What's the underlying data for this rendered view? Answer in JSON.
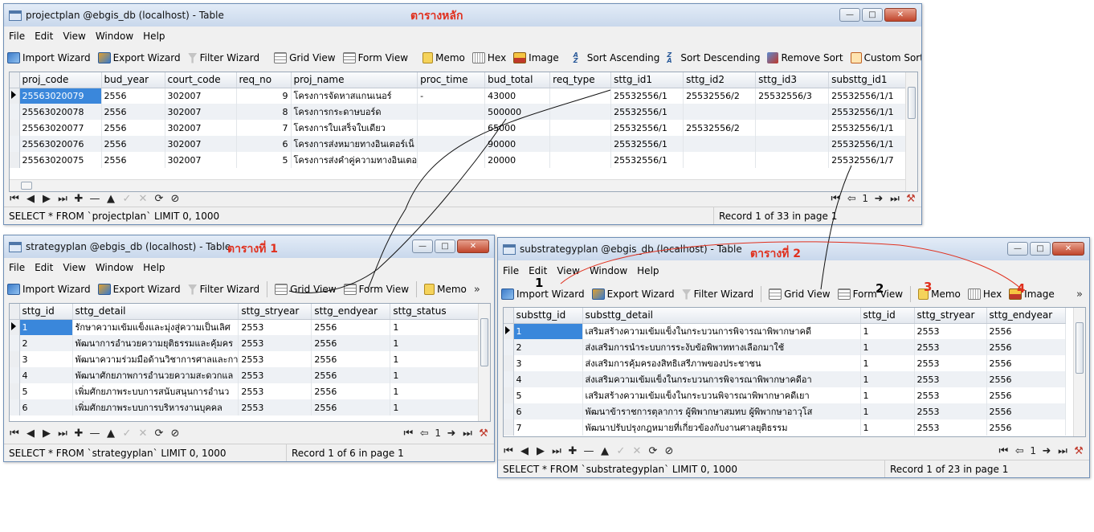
{
  "windows": {
    "project": {
      "title": "projectplan @ebgis_db (localhost) - Table",
      "annotation": "ตารางหลัก",
      "menu": [
        "File",
        "Edit",
        "View",
        "Window",
        "Help"
      ],
      "toolbar": {
        "import": "Import Wizard",
        "export": "Export Wizard",
        "filter": "Filter Wizard",
        "grid": "Grid View",
        "form": "Form View",
        "memo": "Memo",
        "hex": "Hex",
        "image": "Image",
        "sort_asc": "Sort Ascending",
        "sort_desc": "Sort Descending",
        "remove_sort": "Remove Sort",
        "custom_sort": "Custom Sort"
      },
      "columns": [
        "proj_code",
        "bud_year",
        "court_code",
        "req_no",
        "proj_name",
        "proc_time",
        "bud_total",
        "req_type",
        "sttg_id1",
        "sttg_id2",
        "sttg_id3",
        "substtg_id1"
      ],
      "rows": [
        [
          "25563020079",
          "2556",
          "302007",
          "9",
          "โครงการจัดหาสแกนเนอร์",
          "-",
          "43000",
          "",
          "25532556/1",
          "25532556/2",
          "25532556/3",
          "25532556/1/1"
        ],
        [
          "25563020078",
          "2556",
          "302007",
          "8",
          "โครงการกระดาษบอร์ด",
          "",
          "500000",
          "",
          "25532556/1",
          "",
          "",
          "25532556/1/1"
        ],
        [
          "25563020077",
          "2556",
          "302007",
          "7",
          "โครงการใบเสร็จใบเดียว",
          "",
          "65000",
          "",
          "25532556/1",
          "25532556/2",
          "",
          "25532556/1/1"
        ],
        [
          "25563020076",
          "2556",
          "302007",
          "6",
          "โครงการส่งหมายทางอินเตอร์เน็",
          "",
          "90000",
          "",
          "25532556/1",
          "",
          "",
          "25532556/1/1"
        ],
        [
          "25563020075",
          "2556",
          "302007",
          "5",
          "โครงการส่งคำคู่ความทางอินเตอ",
          "",
          "20000",
          "",
          "25532556/1",
          "",
          "",
          "25532556/1/7"
        ]
      ],
      "page_num": "1",
      "query": "SELECT * FROM `projectplan` LIMIT 0, 1000",
      "record": "Record 1 of 33 in page 1"
    },
    "strategy": {
      "title": "strategyplan @ebgis_db (localhost) - Table",
      "annotation": "ตารางที่ 1",
      "menu": [
        "File",
        "Edit",
        "View",
        "Window",
        "Help"
      ],
      "toolbar": {
        "import": "Import Wizard",
        "export": "Export Wizard",
        "filter": "Filter Wizard",
        "grid": "Grid View",
        "form": "Form View",
        "memo": "Memo"
      },
      "columns": [
        "sttg_id",
        "sttg_detail",
        "sttg_stryear",
        "sttg_endyear",
        "sttg_status"
      ],
      "rows": [
        [
          "1",
          "รักษาความเข้มแข็งและมุ่งสู่ความเป็นเลิศ",
          "2553",
          "2556",
          "1"
        ],
        [
          "2",
          "พัฒนาการอำนวยความยุติธรรมและคุ้มคร",
          "2553",
          "2556",
          "1"
        ],
        [
          "3",
          "พัฒนาความร่วมมือด้านวิชาการศาลและกา",
          "2553",
          "2556",
          "1"
        ],
        [
          "4",
          "พัฒนาศักยภาพการอำนวยความสะดวกแล",
          "2553",
          "2556",
          "1"
        ],
        [
          "5",
          "เพิ่มศักยภาพระบบการสนับสนุนการอำนว",
          "2553",
          "2556",
          "1"
        ],
        [
          "6",
          "เพิ่มศักยภาพระบบการบริหารงานบุคคล",
          "2553",
          "2556",
          "1"
        ]
      ],
      "page_num": "1",
      "query": "SELECT * FROM `strategyplan` LIMIT 0, 1000",
      "record": "Record 1 of 6 in page 1"
    },
    "substrategy": {
      "title": "substrategyplan @ebgis_db (localhost) - Table",
      "annotation": "ตารางที่ 2",
      "menu": [
        "File",
        "Edit",
        "View",
        "Window",
        "Help"
      ],
      "toolbar": {
        "import": "Import Wizard",
        "export": "Export Wizard",
        "filter": "Filter Wizard",
        "grid": "Grid View",
        "form": "Form View",
        "memo": "Memo",
        "hex": "Hex",
        "image": "Image"
      },
      "markers": [
        "1",
        "2",
        "3",
        "4"
      ],
      "columns": [
        "substtg_id",
        "substtg_detail",
        "sttg_id",
        "sttg_stryear",
        "sttg_endyear"
      ],
      "rows": [
        [
          "1",
          "เสริมสร้างความเข้มแข็งในกระบวนการพิจารณาพิพากษาคดี",
          "1",
          "2553",
          "2556"
        ],
        [
          "2",
          "ส่งเสริมการนำระบบการระงับข้อพิพาททางเลือกมาใช้",
          "1",
          "2553",
          "2556"
        ],
        [
          "3",
          "ส่งเสริมการคุ้มครองสิทธิเสรีภาพของประชาชน",
          "1",
          "2553",
          "2556"
        ],
        [
          "4",
          "ส่งเสริมความเข้มแข็งในกระบวนการพิจารณาพิพากษาคดีอา",
          "1",
          "2553",
          "2556"
        ],
        [
          "5",
          "เสริมสร้างความเข้มแข็งในกระบวนพิจารณาพิพากษาคดีเยา",
          "1",
          "2553",
          "2556"
        ],
        [
          "6",
          "พัฒนาข้าราชการตุลาการ ผู้พิพากษาสมทบ ผู้พิพากษาอาวุโส",
          "1",
          "2553",
          "2556"
        ],
        [
          "7",
          "พัฒนาปรับปรุงกฎหมายที่เกี่ยวข้องกับงานศาลยุติธรรม",
          "1",
          "2553",
          "2556"
        ]
      ],
      "page_num": "1",
      "query": "SELECT * FROM `substrategyplan` LIMIT 0, 1000",
      "record": "Record 1 of 23 in page 1"
    }
  },
  "colors": {
    "annotation": "#e0301e",
    "selection": "#3a87db"
  }
}
